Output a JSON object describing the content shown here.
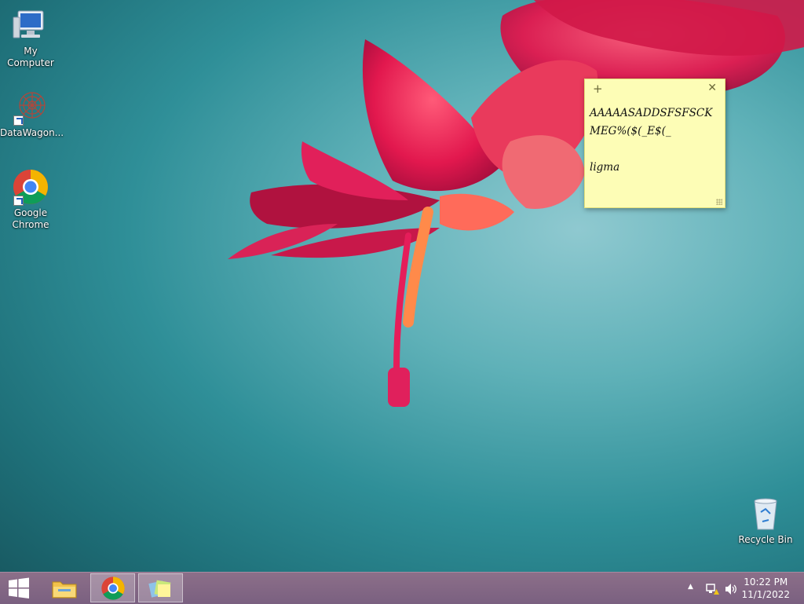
{
  "desktop": {
    "icons": [
      {
        "label": "My Computer"
      },
      {
        "label": "DataWagon..."
      },
      {
        "label": "Google Chrome"
      },
      {
        "label": "Recycle Bin"
      }
    ]
  },
  "sticky_note": {
    "text": "AAAAASADDSFSFSCKMEG%($(_E$(_\n\nligma"
  },
  "taskbar": {
    "start_icon": "windows-logo-icon",
    "pinned": [
      {
        "name": "File Explorer",
        "icon": "folder-icon"
      },
      {
        "name": "Google Chrome",
        "icon": "chrome-icon"
      },
      {
        "name": "Sticky Notes",
        "icon": "sticky-notes-icon"
      }
    ],
    "tray": {
      "time": "10:22 PM",
      "date": "11/1/2022"
    }
  },
  "colors": {
    "taskbar": "#7a6080",
    "sticky_bg": "#fdfdb6",
    "wallpaper_teal": "#2f8f98"
  }
}
